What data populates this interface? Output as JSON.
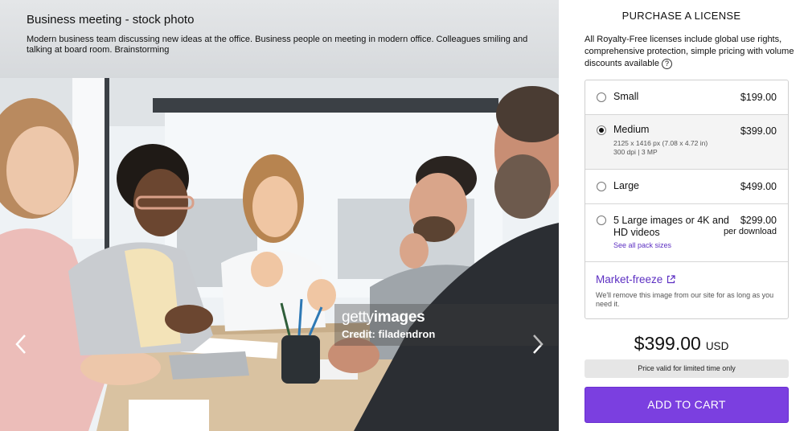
{
  "image": {
    "title": "Business meeting - stock photo",
    "description": "Modern business team discussing new ideas at the office. Business people on meeting in modern office. Colleagues smiling and talking at board room. Brainstorming",
    "watermark_brand_light": "getty",
    "watermark_brand_bold": "images",
    "watermark_credit": "Credit: filadendron",
    "prev_icon": "chevron-left-icon",
    "next_icon": "chevron-right-icon"
  },
  "license": {
    "heading": "PURCHASE A LICENSE",
    "intro": "All Royalty-Free licenses include global use rights, comprehensive protection, simple pricing with volume discounts available",
    "help_icon_glyph": "?",
    "options": [
      {
        "name": "Small",
        "price": "$199.00",
        "selected": false
      },
      {
        "name": "Medium",
        "price": "$399.00",
        "selected": true,
        "detail_1": "2125 x 1416 px (7.08 x 4.72 in)",
        "detail_2": "300 dpi | 3 MP"
      },
      {
        "name": "Large",
        "price": "$499.00",
        "selected": false
      },
      {
        "name_line1": "5 Large images or 4K and",
        "name_line2": "HD videos",
        "price": "$299.00",
        "price_sub": "per download",
        "link": "See all pack sizes",
        "selected": false
      }
    ],
    "market_freeze": {
      "title": "Market-freeze",
      "text": "We'll remove this image from our site for as long as you need it."
    },
    "total_amount": "$399.00",
    "total_currency": "USD",
    "notice": "Price valid for limited time only",
    "cta": "ADD TO CART"
  },
  "colors": {
    "accent": "#7b3fe0",
    "link": "#5c2fc2"
  }
}
